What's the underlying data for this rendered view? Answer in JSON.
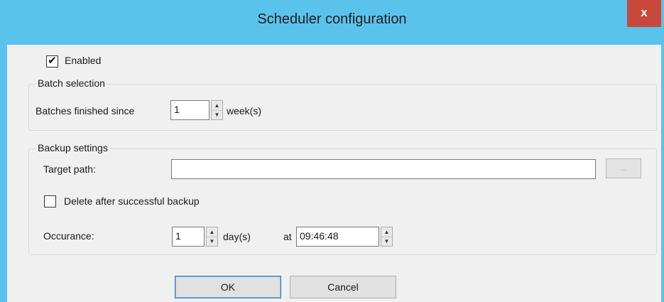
{
  "window": {
    "title": "Scheduler configuration",
    "close_label": "x"
  },
  "enabled": {
    "label": "Enabled",
    "checked": true
  },
  "batch_selection": {
    "legend": "Batch selection",
    "since_label": "Batches finished since",
    "since_value": "1",
    "unit_label": "week(s)"
  },
  "backup_settings": {
    "legend": "Backup settings",
    "target_path_label": "Target path:",
    "target_path_value": "",
    "browse_label": "...",
    "delete_label": "Delete after successful backup",
    "delete_checked": false,
    "occurrence_label": "Occurance:",
    "occurrence_value": "1",
    "occurrence_unit": "day(s)",
    "at_label": "at",
    "time_value": "09:46:48"
  },
  "buttons": {
    "ok_label": "OK",
    "cancel_label": "Cancel"
  },
  "colors": {
    "titlebar": "#5ac3ec",
    "close_button": "#c9483c",
    "client_background": "#f0f0f0"
  }
}
